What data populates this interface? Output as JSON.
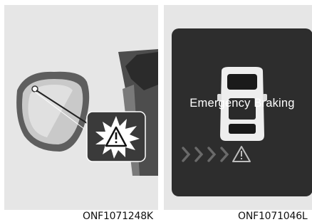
{
  "left_figure": {
    "code": "ONF1071248K",
    "warning_icon": "warning-triangle-icon"
  },
  "right_figure": {
    "code": "ONF1071046L",
    "display_text": "Emergency Braking",
    "warning_icon": "warning-triangle-icon",
    "chevron_icon": "chevron-right-icon"
  },
  "colors": {
    "panel_bg": "#e6e6e6",
    "cluster_bg": "#2d2d2d",
    "text": "#111111"
  }
}
